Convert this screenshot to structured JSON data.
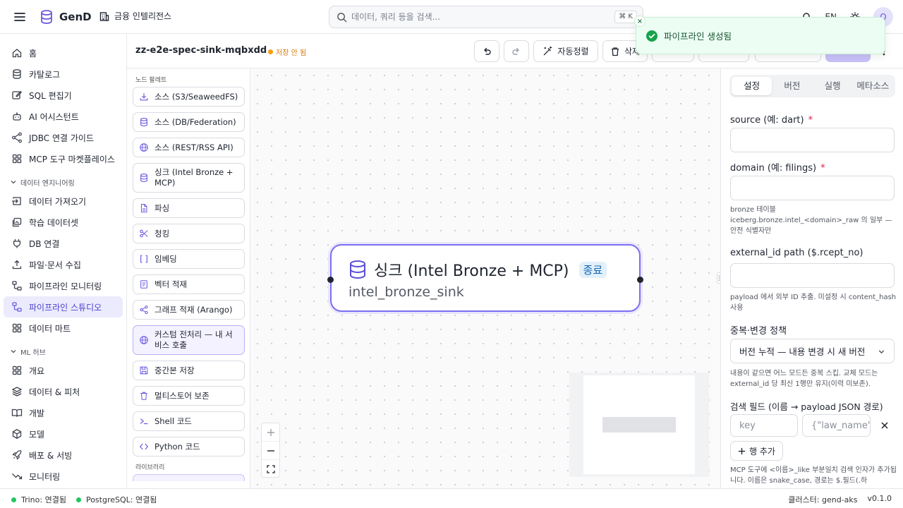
{
  "app": {
    "name": "GenD",
    "workspace": "금융 인텔리전스"
  },
  "search": {
    "placeholder": "데이터, 쿼리 등을 검색...",
    "shortcut": "⌘ K"
  },
  "header": {
    "lang": "EN",
    "avatar": "Q"
  },
  "sidebar": {
    "top_items": [
      {
        "label": "홈",
        "icon": "home-icon"
      },
      {
        "label": "카탈로그",
        "icon": "database-icon"
      },
      {
        "label": "SQL 편집기",
        "icon": "edit-icon"
      },
      {
        "label": "AI 어시스턴트",
        "icon": "bot-icon"
      },
      {
        "label": "JDBC 연결 가이드",
        "icon": "connection-icon"
      },
      {
        "label": "MCP 도구 마켓플레이스",
        "icon": "grid-icon"
      }
    ],
    "de_section": "데이터 엔지니어링",
    "de_items": [
      {
        "label": "데이터 가져오기",
        "icon": "import-icon"
      },
      {
        "label": "학습 데이터셋",
        "icon": "images-icon"
      },
      {
        "label": "DB 연결",
        "icon": "plug-icon"
      },
      {
        "label": "파일·문서 수집",
        "icon": "upload-icon"
      },
      {
        "label": "파이프라인 모니터링",
        "icon": "workflow-icon"
      },
      {
        "label": "파이프라인 스튜디오",
        "icon": "workflow-icon",
        "active": true
      },
      {
        "label": "데이터 마트",
        "icon": "grid-icon"
      }
    ],
    "ml_section": "ML 허브",
    "ml_items": [
      {
        "label": "개요",
        "icon": "grid-icon"
      },
      {
        "label": "데이터 & 피처",
        "icon": "layers-icon"
      },
      {
        "label": "개발",
        "icon": "book-icon"
      },
      {
        "label": "모델",
        "icon": "cube-icon"
      },
      {
        "label": "배포 & 서빙",
        "icon": "rocket-icon"
      },
      {
        "label": "모니터링",
        "icon": "trend-icon"
      }
    ]
  },
  "editor": {
    "pipeline_name": "zz-e2e-spec-sink-mqbxdd",
    "unsaved": "저장 안 됨",
    "auto_layout": "자동정렬",
    "delete": "삭제"
  },
  "toast": {
    "message": "파이프라인 생성됨"
  },
  "palette": {
    "title": "노드 팔레트",
    "items": [
      {
        "label": "소스 (S3/SeaweedFS)",
        "icon": "download-icon"
      },
      {
        "label": "소스 (DB/Federation)",
        "icon": "database-icon"
      },
      {
        "label": "소스 (REST/RSS API)",
        "icon": "globe-icon"
      },
      {
        "label": "싱크 (Intel Bronze + MCP)",
        "icon": "database-icon"
      },
      {
        "label": "파싱",
        "icon": "file-icon"
      },
      {
        "label": "청킹",
        "icon": "scissors-icon"
      },
      {
        "label": "임베딩",
        "icon": "brackets-icon"
      },
      {
        "label": "벡터 적재",
        "icon": "document-icon"
      },
      {
        "label": "그래프 적재 (Arango)",
        "icon": "share-icon"
      },
      {
        "label": "커스텀 전처리 — 내 서비스 호출",
        "icon": "globe-icon",
        "highlight": true
      },
      {
        "label": "중간본 저장",
        "icon": "save-icon"
      },
      {
        "label": "멀티스토어 보존",
        "icon": "trash-icon"
      },
      {
        "label": "Shell 코드",
        "icon": "terminal-icon"
      },
      {
        "label": "Python 코드",
        "icon": "code-icon"
      }
    ],
    "library_title": "라이브러리"
  },
  "node": {
    "title": "싱크 (Intel Bronze + MCP)",
    "badge": "종료",
    "subtitle": "intel_bronze_sink"
  },
  "panel": {
    "tabs": [
      "설정",
      "버전",
      "실행",
      "메타소스"
    ],
    "fields": {
      "source_label": "source (예: dart)",
      "domain_label": "domain (예: filings)",
      "domain_help": "bronze 테이블 iceberg.bronze.intel_<domain>_raw 의 일부 — 안전 식별자만",
      "extid_label": "external_id path ($.rcept_no)",
      "extid_help": "payload 에서 외부 ID 추출. 미설정 시 content_hash 사용",
      "dedup_label": "중복·변경 정책",
      "dedup_value": "버전 누적 — 내용 변경 시 새 버전",
      "dedup_help": "내용이 같으면 어느 모드든 중복 스킵. 교체 모드는 external_id 당 최신 1행만 유지(이력 미보존).",
      "search_label": "검색 필드 (이름 → payload JSON 경로)",
      "key_placeholder": "key",
      "path_placeholder": "{\"law_name\"",
      "add_row": "행 추가",
      "search_help": "MCP 도구에 <이름>_like 부분일치 검색 인자가 추가됩니다. 이름은 snake_case, 경로는 $.필드(.하"
    }
  },
  "status": {
    "trino": "Trino: 연결됨",
    "pg": "PostgreSQL: 연결됨",
    "cluster": "클러스터: gend-aks",
    "version": "v0.1.0"
  },
  "colors": {
    "accent": "#6b5be0",
    "success": "#22c55e",
    "warning": "#f59e0b",
    "required": "#e11d48"
  }
}
